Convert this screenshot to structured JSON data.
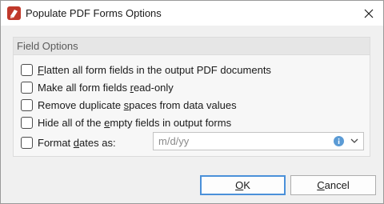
{
  "window": {
    "title": "Populate PDF Forms Options"
  },
  "group": {
    "title": "Field Options"
  },
  "options": [
    {
      "pre": "",
      "accel": "F",
      "post": "latten all form fields in the output PDF documents",
      "checked": false
    },
    {
      "pre": "Make all form fields ",
      "accel": "r",
      "post": "ead-only",
      "checked": false
    },
    {
      "pre": "Remove duplicate ",
      "accel": "s",
      "post": "paces from data values",
      "checked": false
    },
    {
      "pre": "Hide all of the ",
      "accel": "e",
      "post": "mpty fields in output forms",
      "checked": false
    },
    {
      "pre": "Format ",
      "accel": "d",
      "post": "ates as:",
      "checked": false
    }
  ],
  "date_format": {
    "value": "m/d/yy"
  },
  "buttons": {
    "ok_accel": "O",
    "ok_rest": "K",
    "cancel_accel": "C",
    "cancel_rest": "ancel"
  },
  "colors": {
    "accent": "#4a90d9",
    "app_icon": "#c0392b",
    "info_icon": "#5b9bd5"
  },
  "icons": {
    "app": "pdf-xchange-icon",
    "close": "close-icon",
    "info": "info-icon",
    "dropdown": "chevron-down-icon"
  }
}
